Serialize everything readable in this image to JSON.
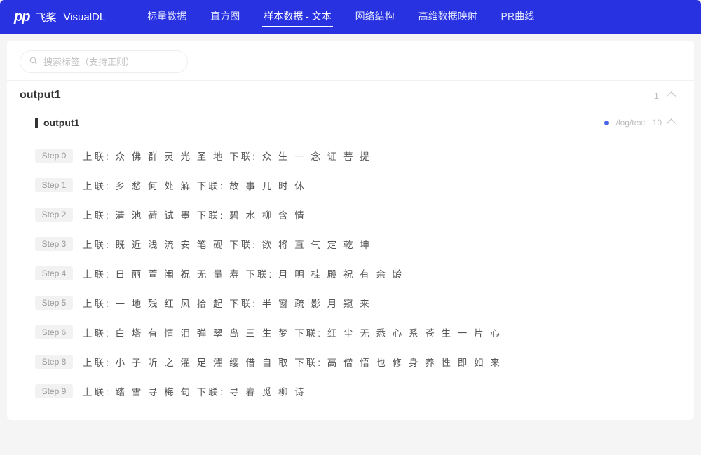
{
  "header": {
    "logo_cn": "飞桨",
    "logo_en": "VisualDL",
    "nav": [
      {
        "label": "标量数据",
        "active": false
      },
      {
        "label": "直方图",
        "active": false
      },
      {
        "label": "样本数据 - 文本",
        "active": true
      },
      {
        "label": "网络结构",
        "active": false
      },
      {
        "label": "高维数据映射",
        "active": false
      },
      {
        "label": "PR曲线",
        "active": false
      }
    ]
  },
  "search": {
    "placeholder": "搜索标签（支持正则）"
  },
  "panel": {
    "title": "output1",
    "count": "1",
    "sub_title": "output1",
    "run_label": "/log/text",
    "run_value": "10"
  },
  "steps": [
    {
      "badge": "Step 0",
      "text": "上联: 众 佛 群 灵 光 圣 地 下联: 众 生 一 念 证 菩 提"
    },
    {
      "badge": "Step 1",
      "text": "上联: 乡 愁 何 处 解 下联: 故 事 几 时 休"
    },
    {
      "badge": "Step 2",
      "text": "上联: 清 池 荷 试 墨 下联: 碧 水 柳 含 情"
    },
    {
      "badge": "Step 3",
      "text": "上联: 既 近 浅 流 安 笔 砚 下联: 欲 将 直 气 定 乾 坤"
    },
    {
      "badge": "Step 4",
      "text": "上联: 日 丽 萱 闱 祝 无 量 寿 下联: 月 明 桂 殿 祝 有 余 龄"
    },
    {
      "badge": "Step 5",
      "text": "上联: 一 地 残 红 风 拾 起 下联: 半 窗 疏 影 月 窥 来"
    },
    {
      "badge": "Step 6",
      "text": "上联: 白 塔 有 情 泪 弹 翠 岛 三 生 梦 下联: 红 尘 无 悉 心 系 苍 生 一 片 心"
    },
    {
      "badge": "Step 8",
      "text": "上联: 小 子 听 之 濯 足 濯 缨 借 自 取 下联: 高 僧 悟 也 修 身 养 性 即 如 来"
    },
    {
      "badge": "Step 9",
      "text": "上联: 踏 雪 寻 梅 句 下联: 寻 春 觅 柳 诗"
    }
  ]
}
